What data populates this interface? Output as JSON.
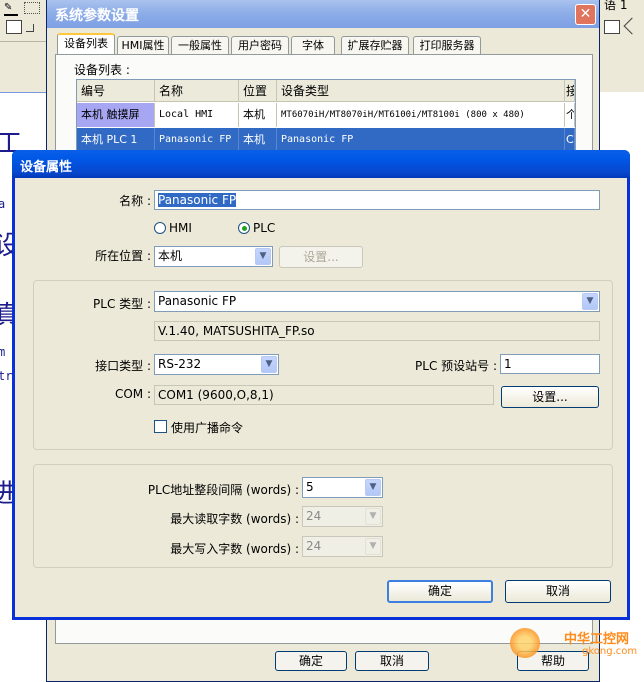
{
  "background_app": {
    "glyphs": [
      "工",
      "a",
      "设",
      "真",
      "m",
      "tr",
      "进"
    ],
    "right_text": "语 1"
  },
  "system_window": {
    "title": "系统参数设置",
    "close_symbol": "✕",
    "tabs": [
      "设备列表",
      "HMI属性",
      "一般属性",
      "用户密码",
      "字体",
      "扩展存贮器",
      "打印服务器"
    ],
    "device_list_label": "设备列表 :",
    "grid": {
      "columns": [
        "编号",
        "名称",
        "位置",
        "设备类型",
        "接"
      ],
      "rows": [
        {
          "id": "本机 触摸屏",
          "name": "Local HMI",
          "location": "本机",
          "type": "MT6070iH/MT8070iH/MT6100i/MT8100i (800 x 480)",
          "extra": "个"
        },
        {
          "id": "本机 PLC 1",
          "name": "Panasonic FP",
          "location": "本机",
          "type": "Panasonic FP",
          "extra": "C"
        }
      ]
    },
    "buttons": {
      "ok": "确定",
      "cancel": "取消",
      "help": "帮助"
    }
  },
  "device_dialog": {
    "title": "设备属性",
    "name_label": "名称 :",
    "name_value": "Panasonic FP",
    "radio_hmi": "HMI",
    "radio_plc": "PLC",
    "selected_radio": "PLC",
    "location_label": "所在位置 :",
    "location_value": "本机",
    "location_settings_button": "设置...",
    "plc_type_label": "PLC 类型 :",
    "plc_type_value": "Panasonic FP",
    "driver_info": "V.1.40, MATSUSHITA_FP.so",
    "interface_label": "接口类型 :",
    "interface_value": "RS-232",
    "station_label": "PLC 预设站号 :",
    "station_value": "1",
    "com_label": "COM :",
    "com_value": "COM1 (9600,O,8,1)",
    "com_settings_button": "设置...",
    "broadcast_label": "使用广播命令",
    "broadcast_checked": false,
    "addr_gap_label": "PLC地址整段间隔 (words) :",
    "addr_gap_value": "5",
    "max_read_label": "最大读取字数 (words) :",
    "max_read_value": "24",
    "max_write_label": "最大写入字数 (words) :",
    "max_write_value": "24",
    "ok_button": "确定",
    "cancel_button": "取消"
  },
  "watermark": {
    "brand": "中华工控网",
    "url": "gkong.com"
  },
  "colors": {
    "title_blue": "#0747cf",
    "selection": "#316ac5",
    "face": "#ece9d8",
    "watermark": "#ff8c1a"
  }
}
